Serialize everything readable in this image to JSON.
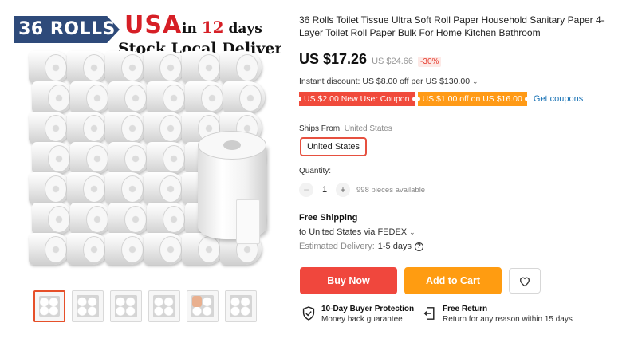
{
  "image": {
    "badge": "36 ROLLS",
    "usa": "USA",
    "in_text": "in",
    "days_number": "12",
    "days_text": "days",
    "stock_text": "Stock  Local Delivery",
    "thumbnail_count": 6,
    "active_thumbnail": 0
  },
  "product": {
    "title": "36 Rolls Toilet Tissue Ultra Soft Roll Paper Household Sanitary Paper 4-Layer Toilet Roll Paper Bulk For Home Kitchen Bathroom",
    "price": "US $17.26",
    "original_price": "US $24.66",
    "discount": "-30%"
  },
  "promos": {
    "instant_discount": "Instant discount: US $8.00 off per US $130.00",
    "coupon_1": "US $2.00 New User Coupon",
    "coupon_2": "US $1.00 off on US $16.00",
    "get_coupons": "Get coupons"
  },
  "ships_from": {
    "label": "Ships From:",
    "value": "United States",
    "option": "United States"
  },
  "quantity": {
    "label": "Quantity:",
    "value": "1",
    "minus": "−",
    "plus": "+",
    "available": "998 pieces available"
  },
  "shipping": {
    "title": "Free Shipping",
    "destination": "to United States via FEDEX",
    "estimated_label": "Estimated Delivery:",
    "estimated_value": "1-5 days"
  },
  "actions": {
    "buy_now": "Buy Now",
    "add_to_cart": "Add to Cart"
  },
  "guarantees": {
    "protection_title": "10-Day Buyer Protection",
    "protection_sub": "Money back guarantee",
    "return_title": "Free Return",
    "return_sub": "Return for any reason within 15 days"
  },
  "colors": {
    "accent_red": "#f0473d",
    "accent_orange": "#ff9c11",
    "link_blue": "#1a73b5",
    "badge_navy": "#2e4a7a"
  },
  "icons": [
    "chevron-down-icon",
    "question-icon",
    "heart-icon",
    "shield-check-icon",
    "return-arrow-icon"
  ]
}
